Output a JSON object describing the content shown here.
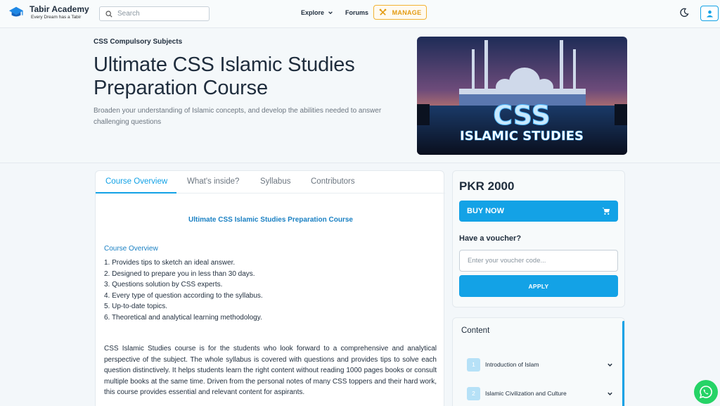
{
  "header": {
    "brand": "Tabir Academy",
    "tagline": "Every Dream has a Tabir",
    "search_placeholder": "Search",
    "explore_label": "Explore",
    "forums_label": "Forums",
    "manage_label": "MANAGE"
  },
  "hero": {
    "breadcrumb": "CSS Compulsory Subjects",
    "title": "Ultimate CSS Islamic Studies Preparation Course",
    "subtitle": "Broaden your understanding of Islamic concepts, and develop the abilities needed to answer challenging questions",
    "cover_line1": "CSS",
    "cover_line2": "ISLAMIC STUDIES"
  },
  "tabs": [
    {
      "label": "Course Overview",
      "active": true
    },
    {
      "label": "What's inside?",
      "active": false
    },
    {
      "label": "Syllabus",
      "active": false
    },
    {
      "label": "Contributors",
      "active": false
    }
  ],
  "overview": {
    "title": "Ultimate CSS Islamic Studies Preparation Course",
    "section_heading": "Course Overview",
    "points": [
      "1. Provides tips to sketch an ideal answer.",
      "2. Designed to prepare you in less than 30 days.",
      "3. Questions solution by CSS experts.",
      "4. Every type of question according to the syllabus.",
      "5. Up-to-date topics.",
      "6. Theoretical and analytical learning methodology."
    ],
    "paragraph": "CSS Islamic Studies course is for the students who look forward to a comprehensive and analytical perspective of the subject. The whole syllabus is covered with questions and provides tips to solve each question distinctively. It helps students learn the right content without reading 1000 pages books or consult multiple books at the same time. Driven from the personal notes of many CSS toppers and their hard work, this course provides essential and relevant content for aspirants."
  },
  "pricing": {
    "price": "PKR 2000",
    "buy_label": "BUY NOW",
    "voucher_label": "Have a voucher?",
    "voucher_placeholder": "Enter your voucher code...",
    "apply_label": "APPLY"
  },
  "content_outline": {
    "title": "Content",
    "items": [
      {
        "num": "1",
        "label": "Introduction of Islam"
      },
      {
        "num": "2",
        "label": "Islamic Civilization and Culture"
      }
    ]
  },
  "colors": {
    "accent": "#13a2e6",
    "manage": "#f2b233",
    "whatsapp": "#25d366"
  }
}
